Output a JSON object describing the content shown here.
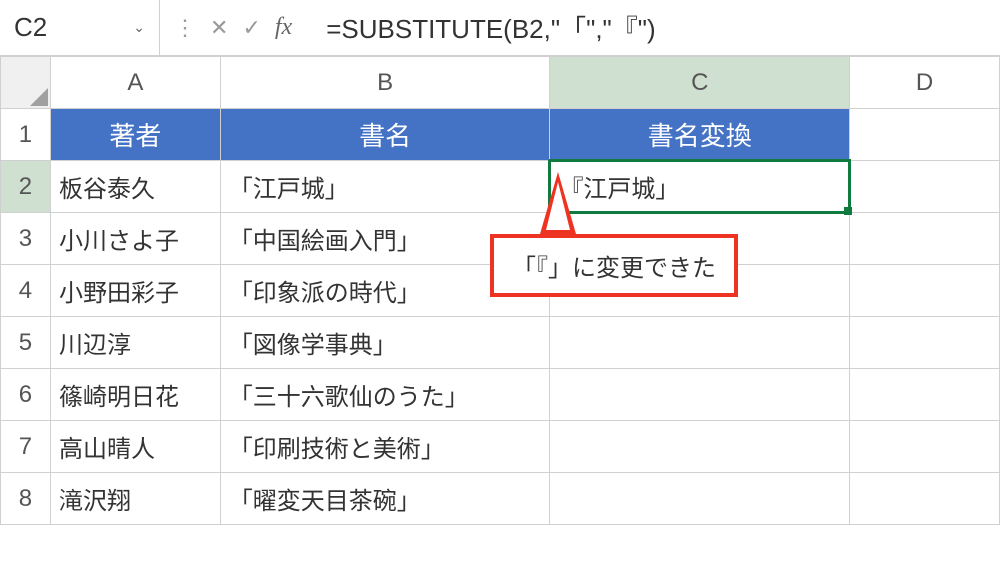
{
  "nameBox": {
    "value": "C2"
  },
  "formulaBar": {
    "fxLabel": "fx",
    "formula": "=SUBSTITUTE(B2,\"「\",\"『\")"
  },
  "columns": [
    "A",
    "B",
    "C",
    "D"
  ],
  "rows": [
    "1",
    "2",
    "3",
    "4",
    "5",
    "6",
    "7",
    "8"
  ],
  "headers": {
    "A": "著者",
    "B": "書名",
    "C": "書名変換"
  },
  "data": {
    "row2": {
      "A": "板谷泰久",
      "B": "「江戸城」",
      "C": "『江戸城」"
    },
    "row3": {
      "A": "小川さよ子",
      "B": "「中国絵画入門」",
      "C": ""
    },
    "row4": {
      "A": "小野田彩子",
      "B": "「印象派の時代」",
      "C": ""
    },
    "row5": {
      "A": "川辺淳",
      "B": "「図像学事典」",
      "C": ""
    },
    "row6": {
      "A": "篠崎明日花",
      "B": "「三十六歌仙のうた」",
      "C": ""
    },
    "row7": {
      "A": "高山晴人",
      "B": "「印刷技術と美術」",
      "C": ""
    },
    "row8": {
      "A": "滝沢翔",
      "B": "「曜変天目茶碗」",
      "C": ""
    }
  },
  "callout": {
    "text": "「『」に変更できた"
  },
  "icons": {
    "dots": "⋮",
    "cancel": "✕",
    "confirm": "✓",
    "dropdown": "⌄"
  }
}
